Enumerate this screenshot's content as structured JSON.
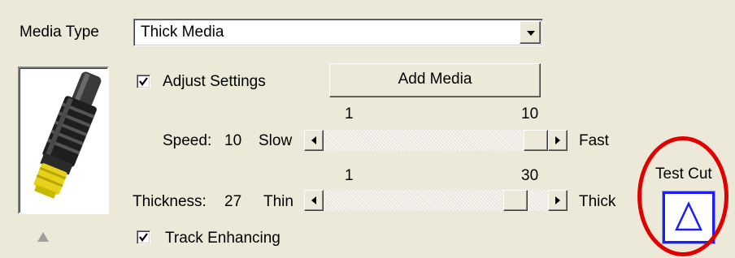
{
  "media_type": {
    "label": "Media Type",
    "selected": "Thick Media"
  },
  "adjust_settings": {
    "label": "Adjust Settings",
    "checked": true
  },
  "add_media_button": "Add Media",
  "speed": {
    "label": "Speed:",
    "value": "10",
    "min_label": "Slow",
    "max_label": "Fast",
    "scale_min": "1",
    "scale_max": "10",
    "position": 1.0
  },
  "thickness": {
    "label": "Thickness:",
    "value": "27",
    "min_label": "Thin",
    "max_label": "Thick",
    "scale_min": "1",
    "scale_max": "30",
    "position": 0.9
  },
  "track_enhancing": {
    "label": "Track Enhancing",
    "checked": true
  },
  "test_cut": {
    "label": "Test Cut"
  },
  "colors": {
    "highlight_ring": "#e00000",
    "test_cut_icon": "#1c1cff"
  }
}
